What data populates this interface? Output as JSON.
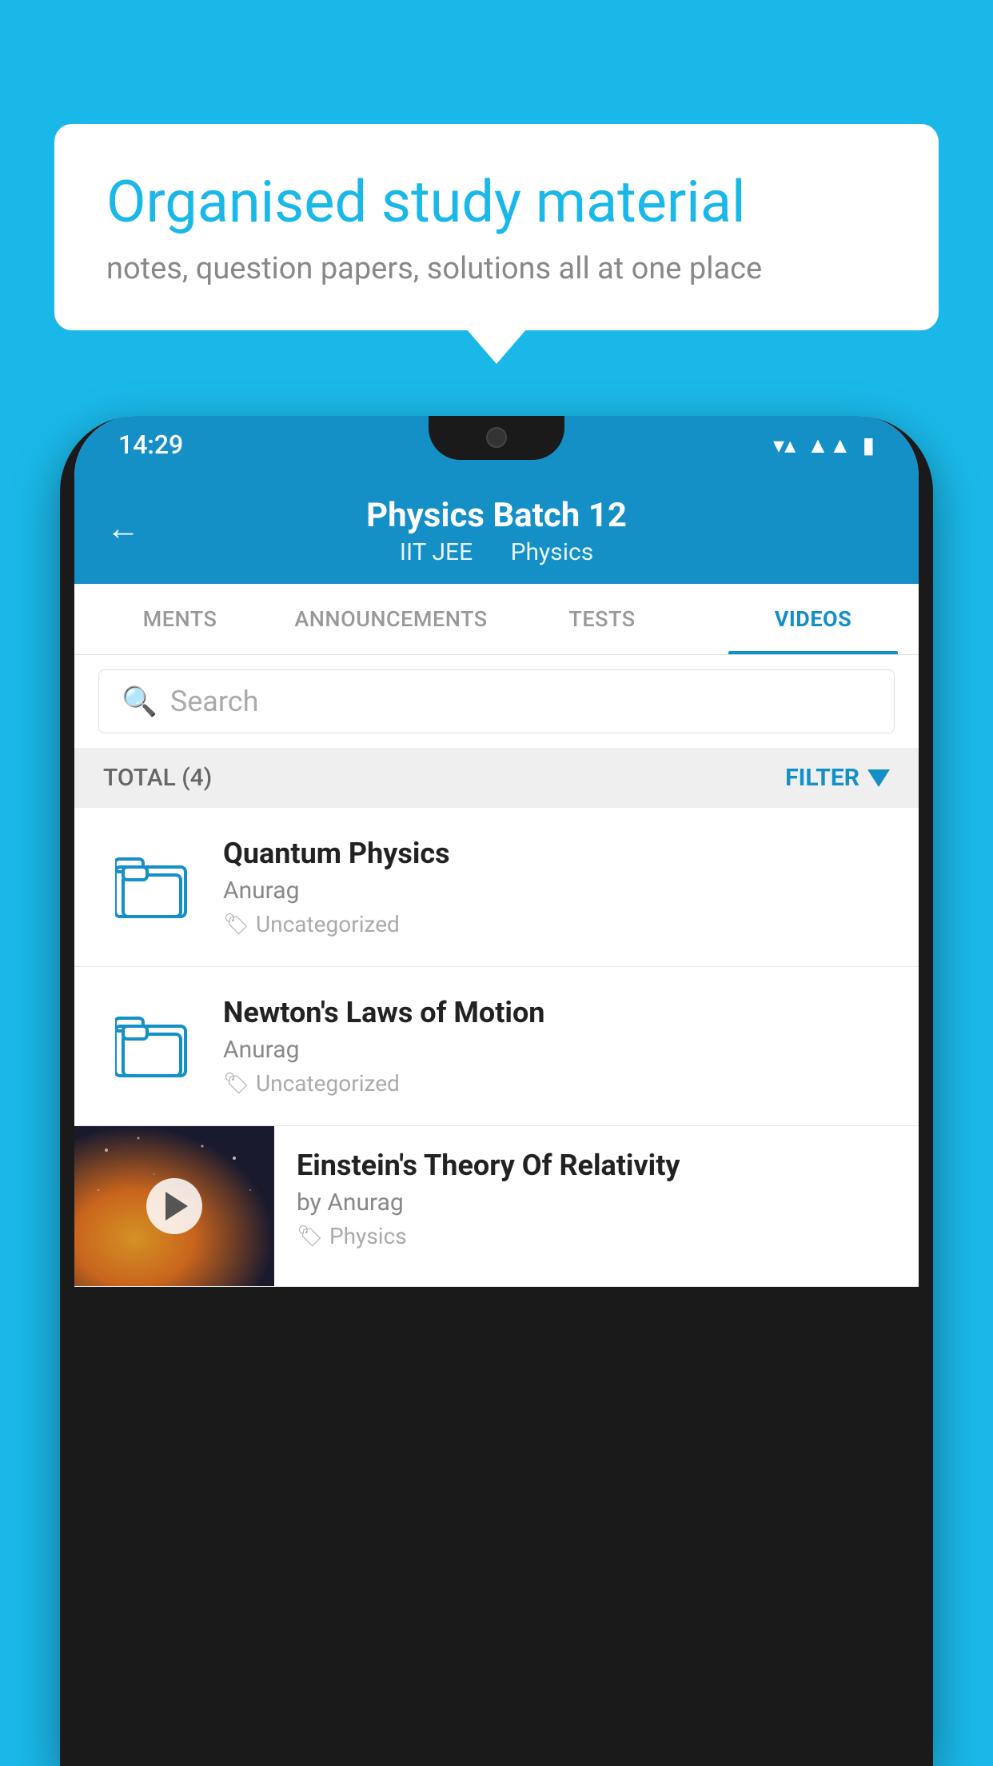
{
  "background_color": "#1ab8e8",
  "speech_bubble": {
    "title": "Organised study material",
    "subtitle": "notes, question papers, solutions all at one place"
  },
  "phone": {
    "status_bar": {
      "time": "14:29"
    },
    "header": {
      "title": "Physics Batch 12",
      "subtitle_left": "IIT JEE",
      "subtitle_right": "Physics",
      "back_label": "←"
    },
    "tabs": [
      {
        "label": "MENTS",
        "active": false
      },
      {
        "label": "ANNOUNCEMENTS",
        "active": false
      },
      {
        "label": "TESTS",
        "active": false
      },
      {
        "label": "VIDEOS",
        "active": true
      }
    ],
    "search": {
      "placeholder": "Search"
    },
    "filter_bar": {
      "total": "TOTAL (4)",
      "filter_label": "FILTER"
    },
    "videos": [
      {
        "id": "1",
        "title": "Quantum Physics",
        "author": "Anurag",
        "tag": "Uncategorized",
        "has_thumb": false
      },
      {
        "id": "2",
        "title": "Newton's Laws of Motion",
        "author": "Anurag",
        "tag": "Uncategorized",
        "has_thumb": false
      },
      {
        "id": "3",
        "title": "Einstein's Theory Of Relativity",
        "author": "by Anurag",
        "tag": "Physics",
        "has_thumb": true
      }
    ]
  }
}
